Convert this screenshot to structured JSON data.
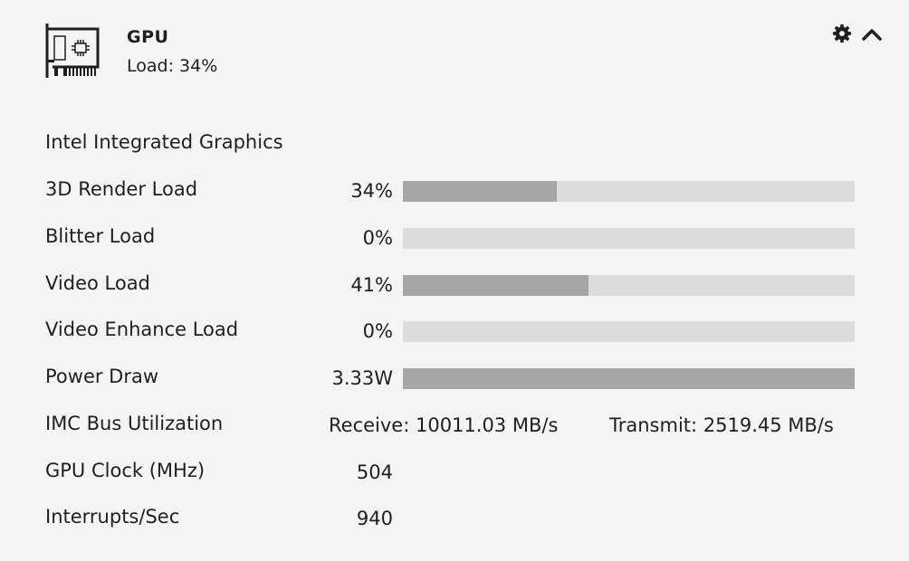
{
  "header": {
    "title": "GPU",
    "subtitle": "Load: 34%",
    "icon": "graphics-card-icon",
    "settings_icon": "gear-icon",
    "collapse_icon": "chevron-up-icon"
  },
  "adapter_name": "Intel Integrated Graphics",
  "colors": {
    "bar_track": "#dcdcdc",
    "bar_fill": "#a6a6a6",
    "background": "#f4f4f4"
  },
  "metrics": [
    {
      "label": "3D Render Load",
      "value": "34%",
      "fill": 0.34
    },
    {
      "label": "Blitter Load",
      "value": "0%",
      "fill": 0
    },
    {
      "label": "Video Load",
      "value": "41%",
      "fill": 0.41
    },
    {
      "label": "Video Enhance Load",
      "value": "0%",
      "fill": 0
    },
    {
      "label": "Power Draw",
      "value": "3.33W",
      "fill": 1.0
    }
  ],
  "imc": {
    "label": "IMC Bus Utilization",
    "receive": "Receive: 10011.03 MB/s",
    "transmit": "Transmit: 2519.45 MB/s"
  },
  "clock": {
    "label": "GPU Clock (MHz)",
    "value": "504"
  },
  "interrupts": {
    "label": "Interrupts/Sec",
    "value": "940"
  }
}
